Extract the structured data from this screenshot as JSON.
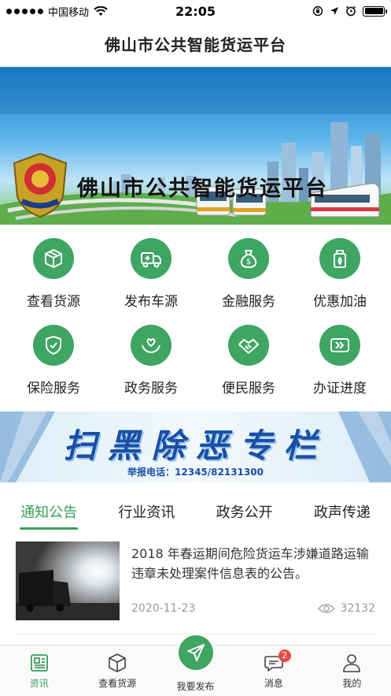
{
  "status_bar": {
    "carrier": "中国移动",
    "time": "22:05",
    "signal_bars": 5,
    "battery_level": 1.0
  },
  "nav": {
    "title": "佛山市公共智能货运平台"
  },
  "banner": {
    "title": "佛山市公共智能货运平台"
  },
  "services": [
    {
      "label": "查看货源",
      "icon": "box-icon"
    },
    {
      "label": "发布车源",
      "icon": "truck-add-icon"
    },
    {
      "label": "金融服务",
      "icon": "money-bag-icon"
    },
    {
      "label": "优惠加油",
      "icon": "fuel-can-icon"
    },
    {
      "label": "保险服务",
      "icon": "shield-check-icon"
    },
    {
      "label": "政务服务",
      "icon": "hands-heart-icon"
    },
    {
      "label": "便民服务",
      "icon": "handshake-icon"
    },
    {
      "label": "办证进度",
      "icon": "progress-arrows-icon"
    }
  ],
  "promo": {
    "title": "扫黑除恶专栏",
    "hotline": "举报电话：12345/82131300"
  },
  "tabs": [
    {
      "label": "通知公告",
      "active": true
    },
    {
      "label": "行业资讯",
      "active": false
    },
    {
      "label": "政务公开",
      "active": false
    },
    {
      "label": "政声传递",
      "active": false
    }
  ],
  "news": [
    {
      "title": "2018 年春运期间危险货运车涉嫌道路运输违章未处理案件信息表的公告。",
      "date": "2020-11-23",
      "views": "32132"
    }
  ],
  "tab_bar": {
    "items": [
      {
        "label": "资讯",
        "icon": "news-icon",
        "active": true
      },
      {
        "label": "查看货源",
        "icon": "cube-icon",
        "active": false
      },
      {
        "label": "我要发布",
        "icon": "send-icon",
        "active": false
      },
      {
        "label": "消息",
        "icon": "message-icon",
        "active": false,
        "badge": "2"
      },
      {
        "label": "我的",
        "icon": "user-icon",
        "active": false
      }
    ]
  },
  "colors": {
    "accent": "#3ea562",
    "active_text": "#3a9d5a",
    "badge": "#e84a4a",
    "promo_text": "#1a4fa8"
  }
}
